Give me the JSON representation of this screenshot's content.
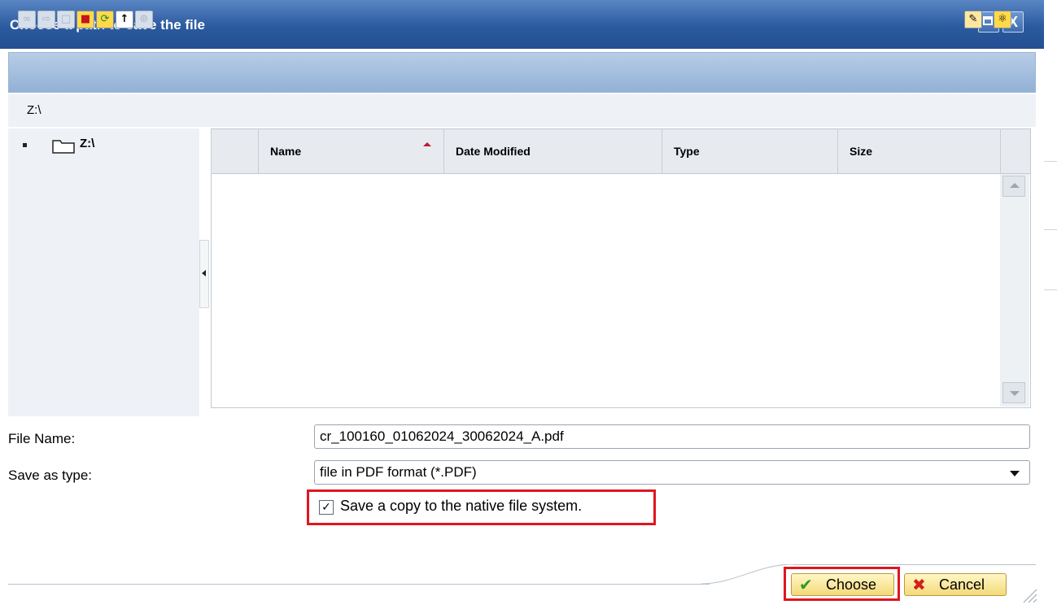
{
  "dialog": {
    "title": "Choose a path to save the file",
    "path": "Z:\\"
  },
  "window_controls": {
    "close": "X"
  },
  "toolbar": {
    "buttons": [
      {
        "icon": "folder-link-icon",
        "enabled": false
      },
      {
        "icon": "export-icon",
        "enabled": false
      },
      {
        "icon": "delete-icon",
        "enabled": false
      },
      {
        "icon": "new-folder-icon",
        "enabled": true
      },
      {
        "icon": "refresh-folder-icon",
        "enabled": true
      },
      {
        "icon": "up-arrow-icon",
        "enabled": true
      },
      {
        "icon": "properties-icon",
        "enabled": false
      },
      {
        "icon": "rename-icon",
        "enabled": true
      },
      {
        "icon": "help-icon",
        "enabled": true
      }
    ]
  },
  "tree": {
    "root": "Z:\\"
  },
  "table": {
    "columns": [
      "Name",
      "Date Modified",
      "Type",
      "Size"
    ],
    "sort_column": "Name",
    "sort_direction": "ascending",
    "rows": []
  },
  "form": {
    "file_name_label": "File Name:",
    "file_name_value": "cr_100160_01062024_30062024_A.pdf",
    "save_type_label": "Save as type:",
    "save_type_value": "file in PDF format (*.PDF)",
    "native_copy_label": "Save a copy to the native file system.",
    "native_copy_checked": true
  },
  "buttons": {
    "choose": "Choose",
    "cancel": "Cancel"
  },
  "colors": {
    "title_bar": "#2b5a9e",
    "highlight": "#e0161e",
    "button": "#f4d97a"
  }
}
